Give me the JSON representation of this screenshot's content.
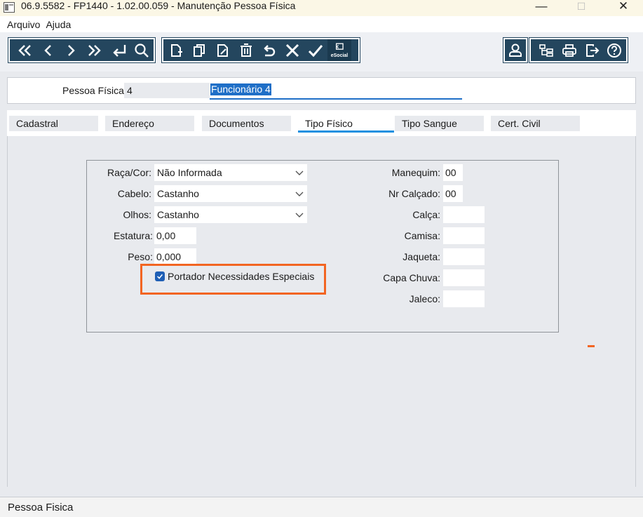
{
  "window": {
    "title": "06.9.5582 - FP1440 - 1.02.00.059 - Manutenção Pessoa Física",
    "minimize_glyph": "—",
    "maximize_glyph": "☐",
    "close_glyph": "✕"
  },
  "menu": {
    "items": [
      "Arquivo",
      "Ajuda"
    ]
  },
  "toolbar": {
    "nav": [
      "first-icon",
      "previous-icon",
      "next-icon",
      "last-icon",
      "return-icon",
      "search-icon"
    ],
    "edit": [
      "new-icon",
      "copy-icon",
      "edit-icon",
      "delete-icon",
      "undo-icon",
      "cancel-icon",
      "confirm-icon",
      "esocial-icon"
    ],
    "esocial_label": "eSocial",
    "right": [
      "user-icon",
      "tree-icon",
      "print-icon",
      "exit-icon",
      "help-icon"
    ]
  },
  "header": {
    "label": "Pessoa Física:",
    "code": "4",
    "name": "Funcionário 4"
  },
  "tabs": [
    {
      "label": "Cadastral"
    },
    {
      "label": "Endereço"
    },
    {
      "label": "Documentos"
    },
    {
      "label": "Tipo Físico"
    },
    {
      "label": "Tipo Sangue"
    },
    {
      "label": "Cert. Civil"
    }
  ],
  "active_tab": "Tipo Físico",
  "form": {
    "raca": {
      "label": "Raça/Cor:",
      "value": "Não Informada"
    },
    "cabelo": {
      "label": "Cabelo:",
      "value": "Castanho"
    },
    "olhos": {
      "label": "Olhos:",
      "value": "Castanho"
    },
    "estatura": {
      "label": "Estatura:",
      "value": "0,00"
    },
    "peso": {
      "label": "Peso:",
      "value": "0,000"
    },
    "necessidades": {
      "label": "Portador Necessidades Especiais",
      "checked": true
    },
    "manequim": {
      "label": "Manequim:",
      "value": "00"
    },
    "calcado": {
      "label": "Nr Calçado:",
      "value": "00"
    },
    "calca": {
      "label": "Calça:",
      "value": ""
    },
    "camisa": {
      "label": "Camisa:",
      "value": ""
    },
    "jaqueta": {
      "label": "Jaqueta:",
      "value": ""
    },
    "capa_chuva": {
      "label": "Capa Chuva:",
      "value": ""
    },
    "jaleco": {
      "label": "Jaleco:",
      "value": ""
    }
  },
  "status": {
    "text": "Pessoa Fisica"
  },
  "colors": {
    "toolbar": "#24465e",
    "highlight": "#f26522",
    "accent": "#1f6fc7"
  }
}
